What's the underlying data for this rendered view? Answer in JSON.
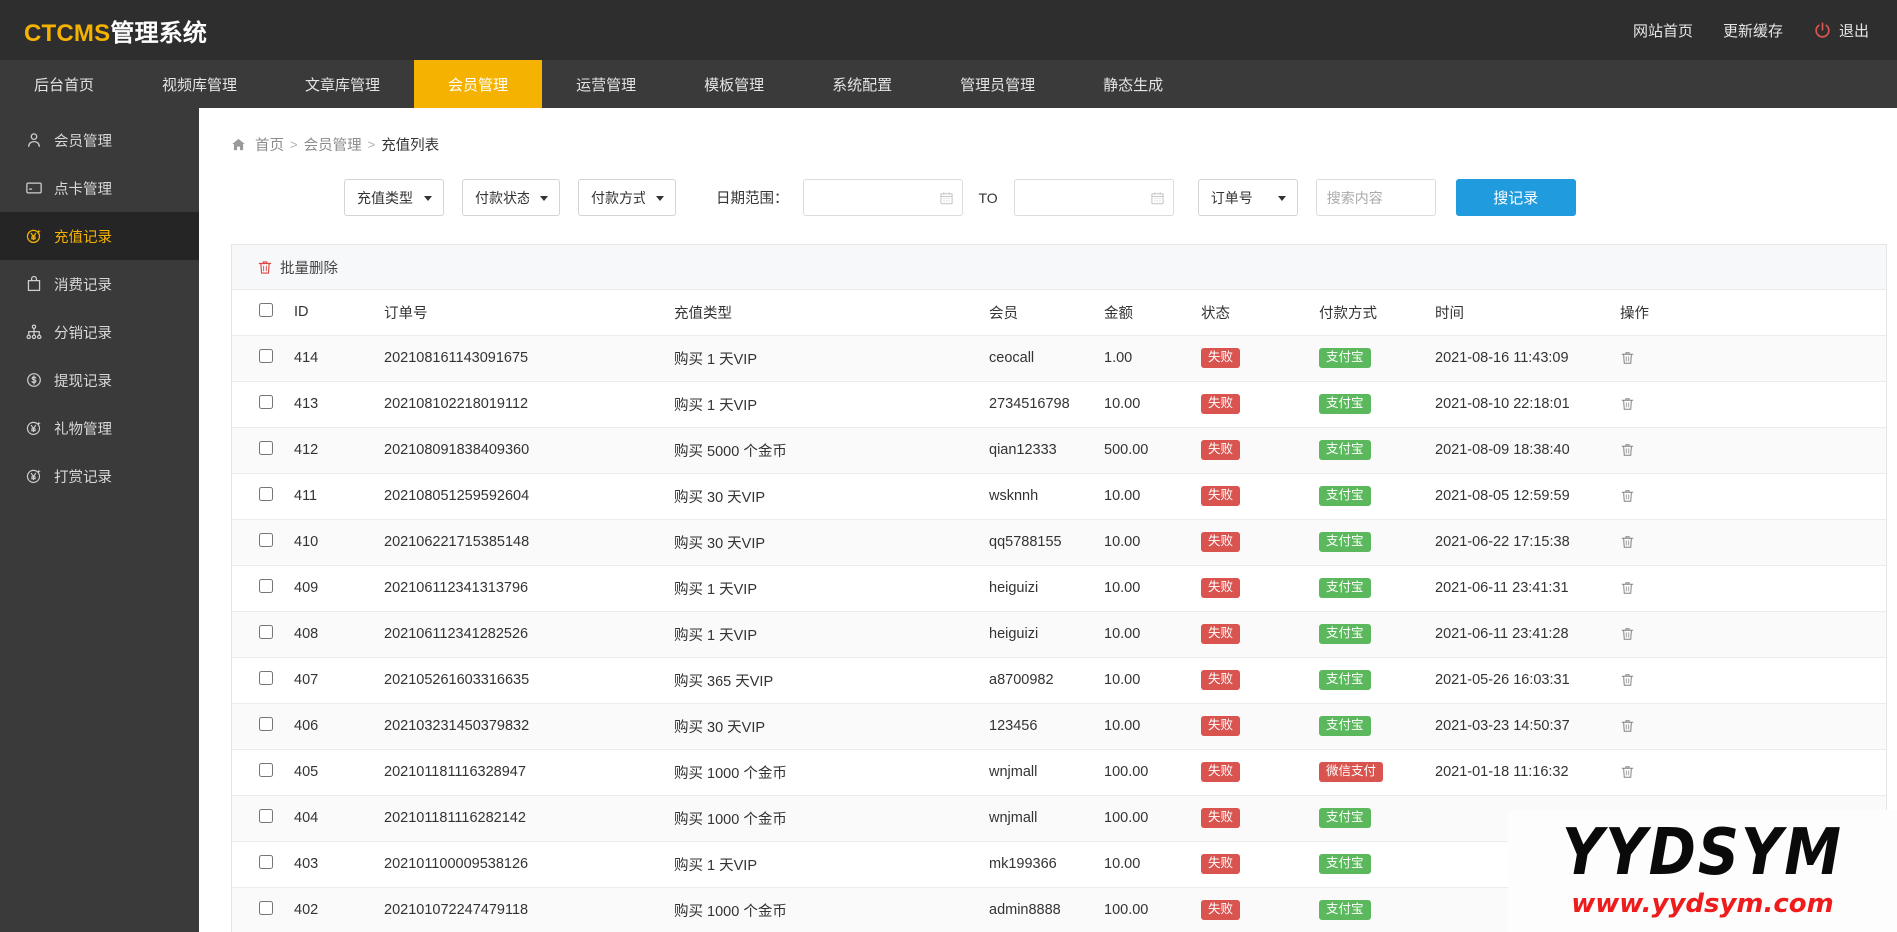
{
  "header": {
    "logo_prefix": "CTCMS",
    "logo_suffix": "管理系统",
    "links": [
      {
        "label": "网站首页",
        "name": "site-home-link"
      },
      {
        "label": "更新缓存",
        "name": "refresh-cache-link"
      }
    ],
    "logout_label": "退出",
    "logout_icon": "power-icon",
    "accent_color": "#f5b200",
    "bar_color": "#2e2e2e"
  },
  "nav": {
    "items": [
      {
        "label": "后台首页",
        "active": false
      },
      {
        "label": "视频库管理",
        "active": false
      },
      {
        "label": "文章库管理",
        "active": false
      },
      {
        "label": "会员管理",
        "active": true
      },
      {
        "label": "运营管理",
        "active": false
      },
      {
        "label": "模板管理",
        "active": false
      },
      {
        "label": "系统配置",
        "active": false
      },
      {
        "label": "管理员管理",
        "active": false
      },
      {
        "label": "静态生成",
        "active": false
      }
    ]
  },
  "sidebar": {
    "items": [
      {
        "label": "会员管理",
        "icon": "user-icon",
        "active": false
      },
      {
        "label": "点卡管理",
        "icon": "card-icon",
        "active": false
      },
      {
        "label": "充值记录",
        "icon": "yen-coin-icon",
        "active": true
      },
      {
        "label": "消费记录",
        "icon": "bag-icon",
        "active": false
      },
      {
        "label": "分销记录",
        "icon": "sitemap-icon",
        "active": false
      },
      {
        "label": "提现记录",
        "icon": "dollar-circle-icon",
        "active": false
      },
      {
        "label": "礼物管理",
        "icon": "yen-coin-icon",
        "active": false
      },
      {
        "label": "打赏记录",
        "icon": "yen-coin-icon",
        "active": false
      }
    ]
  },
  "breadcrumb": {
    "home_icon": "home-icon",
    "home": "首页",
    "sep": ">",
    "section": "会员管理",
    "current": "充值列表"
  },
  "filters": {
    "recharge_type": {
      "selected": "充值类型",
      "options": [
        "充值类型"
      ]
    },
    "pay_status": {
      "selected": "付款状态",
      "options": [
        "付款状态"
      ]
    },
    "pay_method": {
      "selected": "付款方式",
      "options": [
        "付款方式"
      ]
    },
    "date_label": "日期范围：",
    "date_start": {
      "value": "",
      "placeholder": ""
    },
    "to_label": "TO",
    "date_end": {
      "value": "",
      "placeholder": ""
    },
    "search_field": {
      "selected": "订单号",
      "options": [
        "订单号"
      ]
    },
    "search_text": {
      "value": "",
      "placeholder": "搜索内容"
    },
    "search_button": "搜记录",
    "calendar_icon": "calendar-icon",
    "button_color": "#1f9bde"
  },
  "toolbar": {
    "bulk_delete": "批量删除",
    "bulk_delete_icon": "trash-icon"
  },
  "table": {
    "columns": [
      "",
      "ID",
      "订单号",
      "充值类型",
      "会员",
      "金额",
      "状态",
      "付款方式",
      "时间",
      "操作"
    ],
    "row_action_icon": "trash-icon",
    "rows": [
      {
        "id": "414",
        "order": "202108161143091675",
        "type": "购买 1 天VIP",
        "member": "ceocall",
        "amount": "1.00",
        "status": "失败",
        "pay": "支付宝",
        "pay_kind": "alipay",
        "time": "2021-08-16 11:43:09"
      },
      {
        "id": "413",
        "order": "202108102218019112",
        "type": "购买 1 天VIP",
        "member": "2734516798",
        "amount": "10.00",
        "status": "失败",
        "pay": "支付宝",
        "pay_kind": "alipay",
        "time": "2021-08-10 22:18:01"
      },
      {
        "id": "412",
        "order": "202108091838409360",
        "type": "购买 5000 个金币",
        "member": "qian12333",
        "amount": "500.00",
        "status": "失败",
        "pay": "支付宝",
        "pay_kind": "alipay",
        "time": "2021-08-09 18:38:40"
      },
      {
        "id": "411",
        "order": "202108051259592604",
        "type": "购买 30 天VIP",
        "member": "wsknnh",
        "amount": "10.00",
        "status": "失败",
        "pay": "支付宝",
        "pay_kind": "alipay",
        "time": "2021-08-05 12:59:59"
      },
      {
        "id": "410",
        "order": "202106221715385148",
        "type": "购买 30 天VIP",
        "member": "qq5788155",
        "amount": "10.00",
        "status": "失败",
        "pay": "支付宝",
        "pay_kind": "alipay",
        "time": "2021-06-22 17:15:38"
      },
      {
        "id": "409",
        "order": "202106112341313796",
        "type": "购买 1 天VIP",
        "member": "heiguizi",
        "amount": "10.00",
        "status": "失败",
        "pay": "支付宝",
        "pay_kind": "alipay",
        "time": "2021-06-11 23:41:31"
      },
      {
        "id": "408",
        "order": "202106112341282526",
        "type": "购买 1 天VIP",
        "member": "heiguizi",
        "amount": "10.00",
        "status": "失败",
        "pay": "支付宝",
        "pay_kind": "alipay",
        "time": "2021-06-11 23:41:28"
      },
      {
        "id": "407",
        "order": "202105261603316635",
        "type": "购买 365 天VIP",
        "member": "a8700982",
        "amount": "10.00",
        "status": "失败",
        "pay": "支付宝",
        "pay_kind": "alipay",
        "time": "2021-05-26 16:03:31"
      },
      {
        "id": "406",
        "order": "202103231450379832",
        "type": "购买 30 天VIP",
        "member": "123456",
        "amount": "10.00",
        "status": "失败",
        "pay": "支付宝",
        "pay_kind": "alipay",
        "time": "2021-03-23 14:50:37"
      },
      {
        "id": "405",
        "order": "202101181116328947",
        "type": "购买 1000 个金币",
        "member": "wnjmall",
        "amount": "100.00",
        "status": "失败",
        "pay": "微信支付",
        "pay_kind": "wechat",
        "time": "2021-01-18 11:16:32"
      },
      {
        "id": "404",
        "order": "202101181116282142",
        "type": "购买 1000 个金币",
        "member": "wnjmall",
        "amount": "100.00",
        "status": "失败",
        "pay": "支付宝",
        "pay_kind": "alipay",
        "time": ""
      },
      {
        "id": "403",
        "order": "202101100009538126",
        "type": "购买 1 天VIP",
        "member": "mk199366",
        "amount": "10.00",
        "status": "失败",
        "pay": "支付宝",
        "pay_kind": "alipay",
        "time": ""
      },
      {
        "id": "402",
        "order": "202101072247479118",
        "type": "购买 1000 个金币",
        "member": "admin8888",
        "amount": "100.00",
        "status": "失败",
        "pay": "支付宝",
        "pay_kind": "alipay",
        "time": ""
      }
    ],
    "status_fail_color": "#d9534f",
    "alipay_color": "#5cb85c",
    "wechat_color": "#d9534f"
  },
  "watermark": {
    "top_text": "YYDSYM",
    "bottom_text": "www.yydsym.com",
    "top_color": "#0a0a0a",
    "bottom_color": "#ee1c1c"
  }
}
